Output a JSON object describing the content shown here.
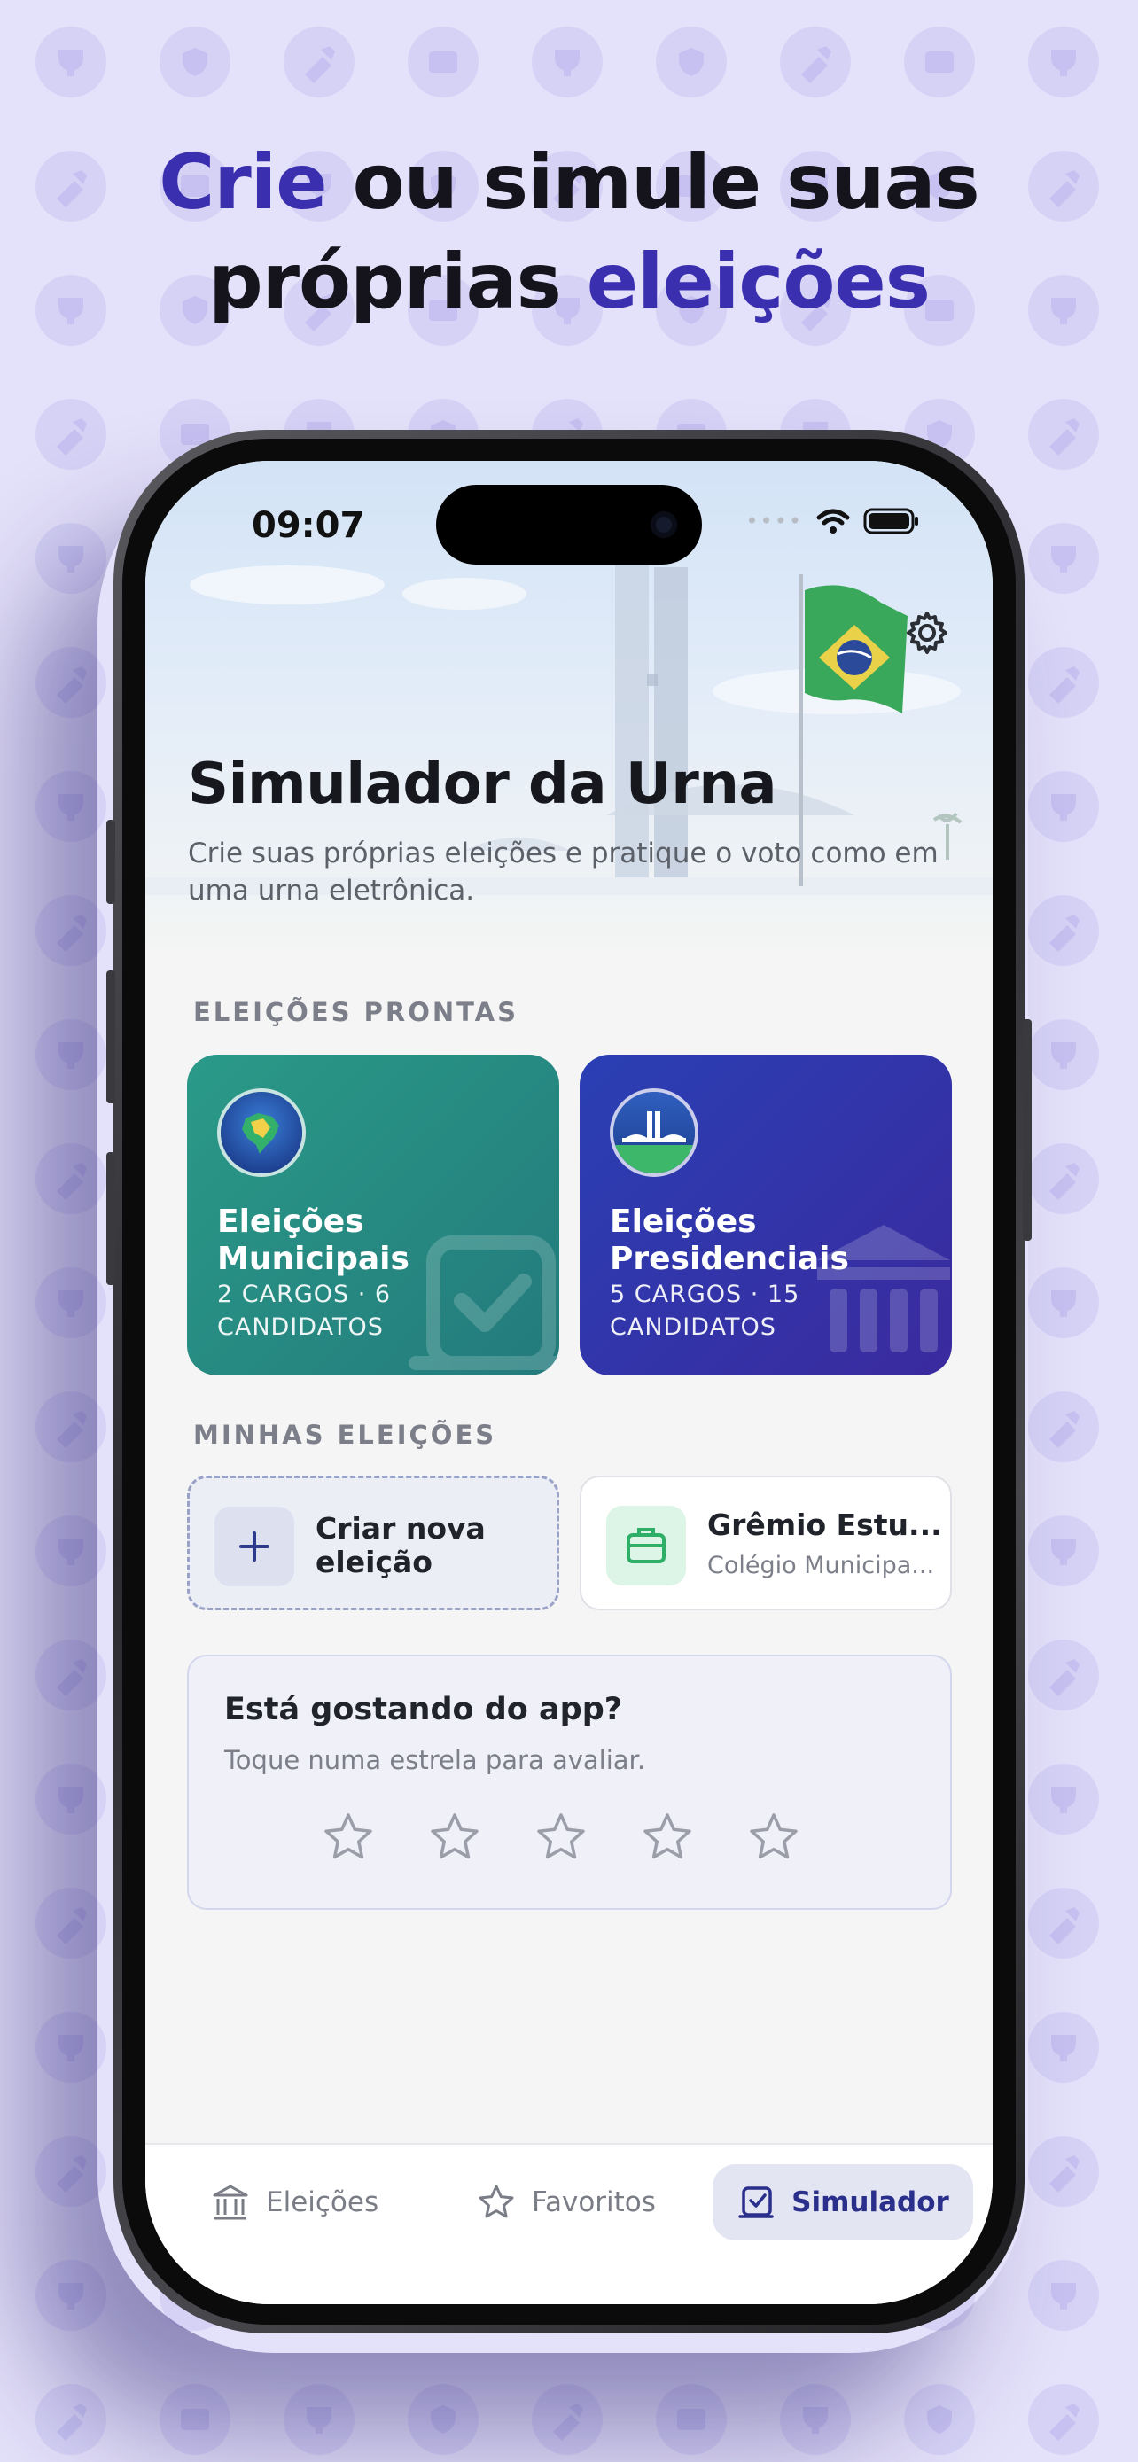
{
  "headline": {
    "line1_accent": "Crie",
    "line1_rest": " ou simule suas",
    "line2_rest": "próprias ",
    "line2_accent": "eleições"
  },
  "status_bar": {
    "time": "09:07"
  },
  "header": {
    "title": "Simulador da Urna",
    "subtitle": "Crie suas próprias eleições e pratique o voto como em uma urna eletrônica."
  },
  "ready_section": {
    "label": "ELEIÇÕES PRONTAS",
    "cards": [
      {
        "title": "Eleições Municipais",
        "subtitle": "2 CARGOS · 6 CANDIDATOS",
        "color": "#2a9a88"
      },
      {
        "title": "Eleições Presidenciais",
        "subtitle": "5 CARGOS · 15 CANDIDATOS",
        "color": "#2f35aa"
      }
    ]
  },
  "my_section": {
    "label": "MINHAS ELEIÇÕES",
    "create_label": "Criar nova eleição",
    "item": {
      "title": "Grêmio Estu...",
      "subtitle": "Colégio Municipa..."
    }
  },
  "rating": {
    "question": "Está gostando do app?",
    "hint": "Toque numa estrela para avaliar.",
    "stars": 5
  },
  "tabbar": {
    "tabs": [
      {
        "label": "Eleições",
        "icon": "institution-icon"
      },
      {
        "label": "Favoritos",
        "icon": "star-icon"
      },
      {
        "label": "Simulador",
        "icon": "ballot-check-icon",
        "active": true
      }
    ]
  },
  "colors": {
    "accent": "#3a2fae",
    "background": "#e4e1fa"
  }
}
